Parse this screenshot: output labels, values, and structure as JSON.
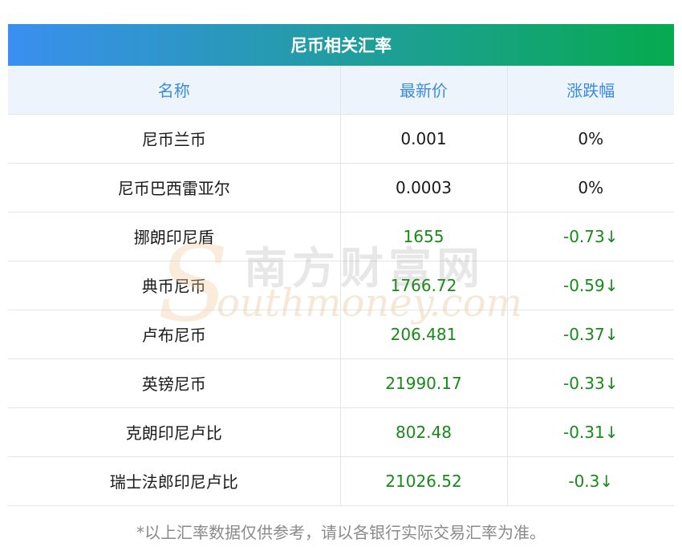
{
  "table": {
    "title": "尼币相关汇率",
    "headers": {
      "name": "名称",
      "price": "最新价",
      "change": "涨跌幅"
    },
    "rows": [
      {
        "name": "尼币兰币",
        "price": "0.001",
        "change": "0%",
        "trend": "flat"
      },
      {
        "name": "尼币巴西雷亚尔",
        "price": "0.0003",
        "change": "0%",
        "trend": "flat"
      },
      {
        "name": "挪朗印尼盾",
        "price": "1655",
        "change": "-0.73↓",
        "trend": "down"
      },
      {
        "name": "典币尼币",
        "price": "1766.72",
        "change": "-0.59↓",
        "trend": "down"
      },
      {
        "name": "卢布尼币",
        "price": "206.481",
        "change": "-0.37↓",
        "trend": "down"
      },
      {
        "name": "英镑尼币",
        "price": "21990.17",
        "change": "-0.33↓",
        "trend": "down"
      },
      {
        "name": "克朗印尼卢比",
        "price": "802.48",
        "change": "-0.31↓",
        "trend": "down"
      },
      {
        "name": "瑞士法郎印尼卢比",
        "price": "21026.52",
        "change": "-0.3↓",
        "trend": "down"
      }
    ]
  },
  "footnote": "*以上汇率数据仅供参考，请以各银行实际交易汇率为准。",
  "watermark": {
    "logo_letter": "S",
    "cn": "南方财富网",
    "en": "outhmoney.com"
  },
  "colors": {
    "title_gradient_start": "#3a8ff0",
    "title_gradient_end": "#06aa4e",
    "header_text": "#3a8be0",
    "header_bg": "#eef4fb",
    "down": "#178a17",
    "footnote": "#8a8a8a"
  }
}
